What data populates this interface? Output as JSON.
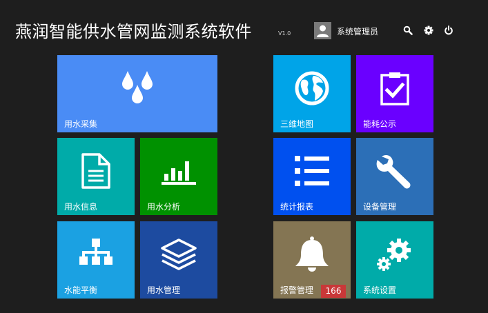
{
  "header": {
    "title": "燕润智能供水管网监测系统软件",
    "version": "V1.0",
    "user_name": "系统管理员",
    "icons": [
      "user-avatar",
      "search-icon",
      "gear-icon",
      "power-icon"
    ]
  },
  "tiles": {
    "water_collection": {
      "label": "用水采集",
      "color": "#4a8cf5",
      "icon": "water-drops-icon"
    },
    "water_info": {
      "label": "用水信息",
      "color": "#00aba9",
      "icon": "document-icon"
    },
    "water_analysis": {
      "label": "用水分析",
      "color": "#009100",
      "icon": "bar-chart-icon"
    },
    "energy_balance": {
      "label": "水能平衡",
      "color": "#1ba1e2",
      "icon": "hierarchy-icon"
    },
    "water_management": {
      "label": "用水管理",
      "color": "#1d4ba0",
      "icon": "layers-icon"
    },
    "map_3d": {
      "label": "三维地图",
      "color": "#00a4e8",
      "icon": "globe-icon"
    },
    "energy_publicity": {
      "label": "能耗公示",
      "color": "#6a00ff",
      "icon": "clipboard-check-icon"
    },
    "statistics_report": {
      "label": "统计报表",
      "color": "#0050ef",
      "icon": "list-icon"
    },
    "device_management": {
      "label": "设备管理",
      "color": "#2c6fb7",
      "icon": "wrench-icon"
    },
    "alarm_management": {
      "label": "报警管理",
      "color": "#847553",
      "icon": "bell-icon",
      "badge": "166"
    },
    "system_settings": {
      "label": "系统设置",
      "color": "#00aba9",
      "icon": "gears-icon"
    }
  }
}
